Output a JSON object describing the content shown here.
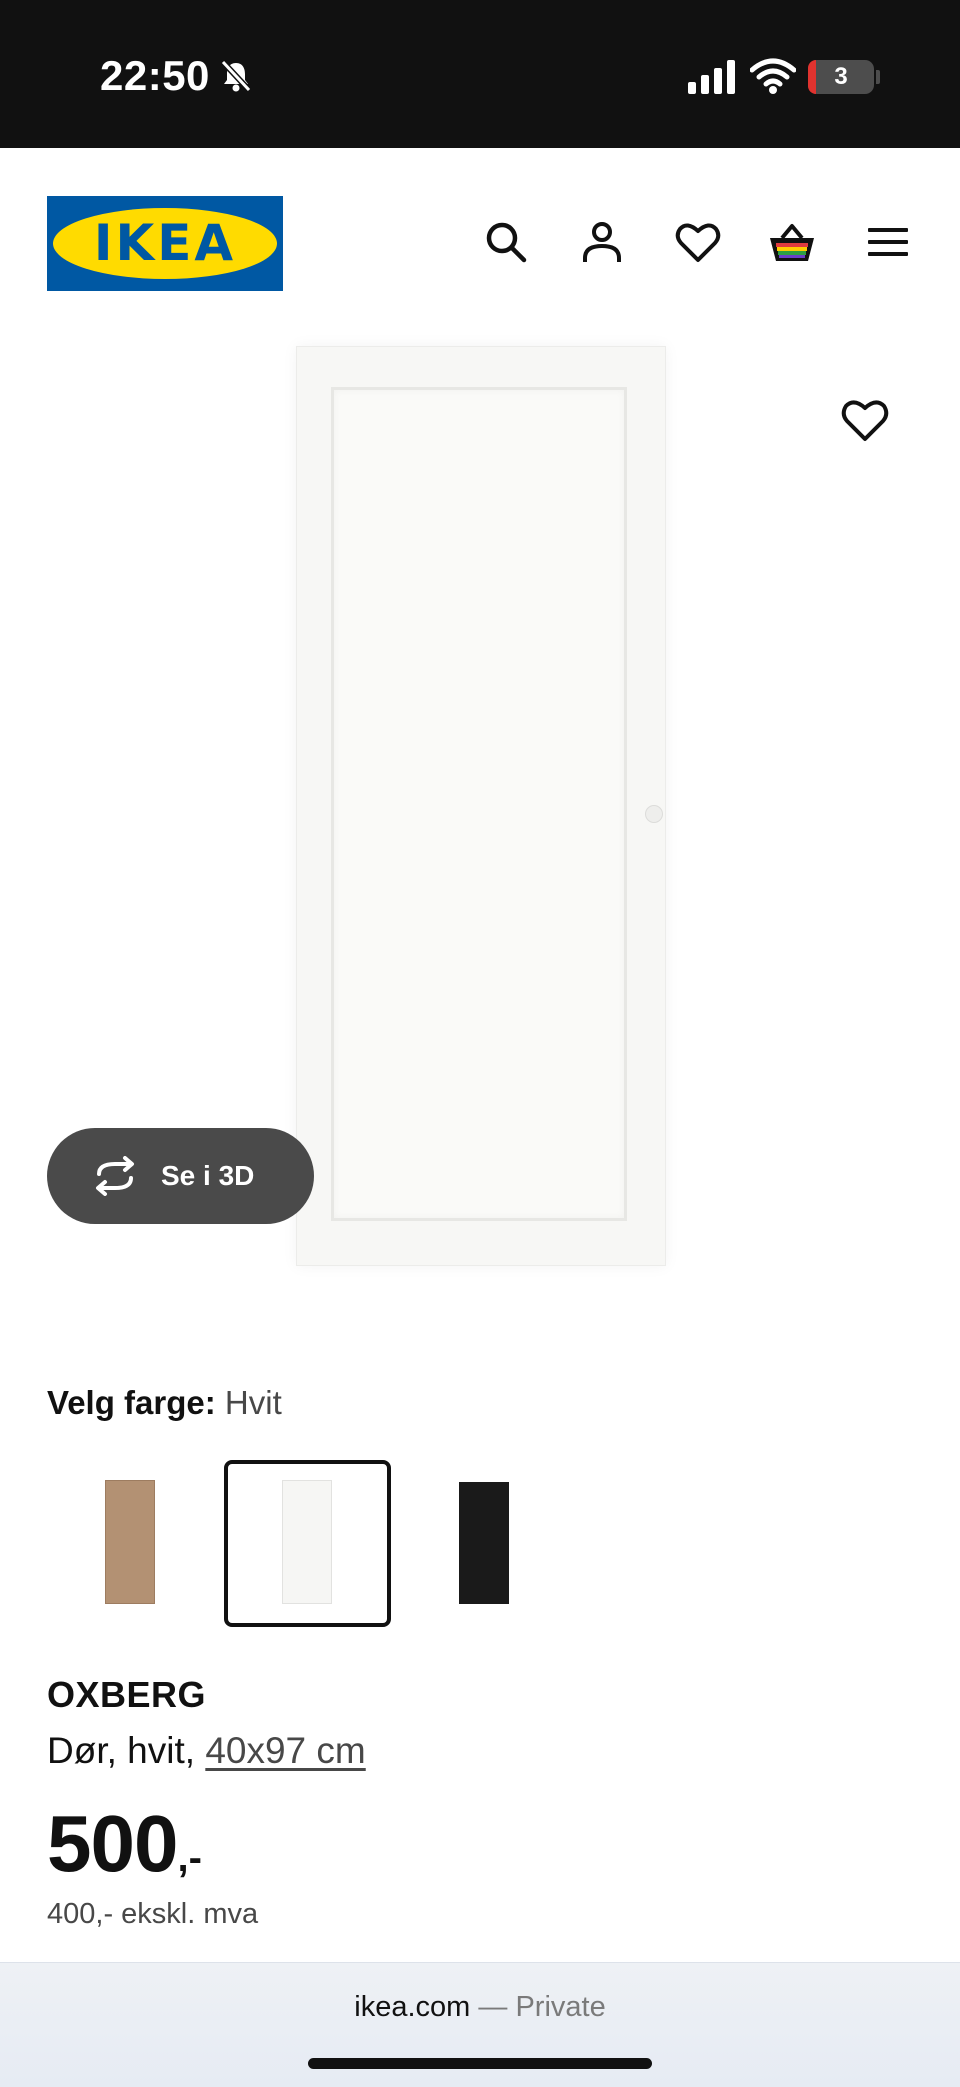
{
  "status_bar": {
    "time": "22:50",
    "battery_level": "3",
    "icons": [
      "bell-slash-icon",
      "cellular-signal-icon",
      "wifi-icon",
      "battery-icon"
    ]
  },
  "header": {
    "logo_text": "IKEA",
    "logo_colors": {
      "background": "#0058a3",
      "oval": "#ffdb00",
      "text": "#0058a3"
    },
    "icons": [
      "search-icon",
      "account-icon",
      "heart-icon",
      "basket-icon",
      "menu-icon"
    ]
  },
  "product_image": {
    "favorite_icon": "heart-icon",
    "see_3d_label": "Se i 3D",
    "see_3d_icon": "rotate-3d-icon"
  },
  "color_selection": {
    "label": "Velg farge:",
    "selected": "Hvit",
    "swatches": [
      {
        "name": "oak-effect",
        "color": "#b39173",
        "selected": false
      },
      {
        "name": "white",
        "color": "#f6f6f4",
        "selected": true
      },
      {
        "name": "black",
        "color": "#1a1a1a",
        "selected": false
      }
    ]
  },
  "product": {
    "name": "OXBERG",
    "description": "Dør, hvit,",
    "size": "40x97 cm",
    "price_integer": "500",
    "price_suffix": ",-",
    "price_ex_vat": "400,- ekskl. mva"
  },
  "browser": {
    "domain": "ikea.com",
    "mode": "— Private"
  },
  "colors": {
    "status_bar_bg": "#111111",
    "see_3d_bg": "#4a4a4a",
    "secondary_text": "#484848"
  }
}
